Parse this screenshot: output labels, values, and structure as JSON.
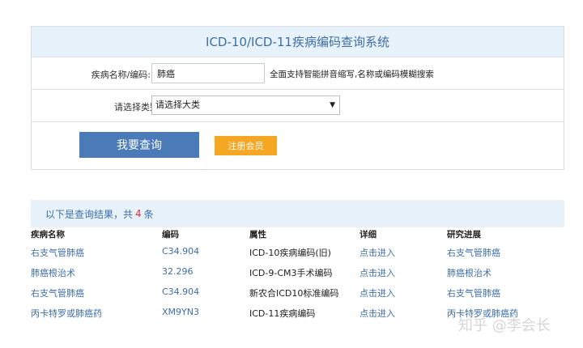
{
  "form": {
    "title": "ICD-10/ICD-11疾病编码查询系统",
    "name_label": "疾病名称/编码:",
    "name_value": "肺癌",
    "name_hint": "全面支持智能拼音缩写,名称或编码模糊搜索",
    "category_label": "请选择类别",
    "category_selected": "请选择大类",
    "search_button": "我要查询",
    "register_button": "注册会员"
  },
  "results": {
    "prefix": "以下是查询结果，共",
    "count": "4",
    "suffix": "条",
    "headers": [
      "疾病名称",
      "编码",
      "属性",
      "详细",
      "研究进展"
    ],
    "rows": [
      [
        "右支气管肺癌",
        "C34.904",
        "ICD-10疾病编码(旧)",
        "点击进入",
        "右支气管肺癌"
      ],
      [
        "肺癌根治术",
        "32.296",
        "ICD-9-CM3手术编码",
        "点击进入",
        "肺癌根治术"
      ],
      [
        "右支气管肺癌",
        "C34.904",
        "新农合ICD10标准编码",
        "点击进入",
        "右支气管肺癌"
      ],
      [
        "丙卡特罗或肺癌药",
        "XM9YN3",
        "ICD-11疾病编码",
        "点击进入",
        "丙卡特罗或肺癌药"
      ]
    ]
  },
  "watermark": "知乎 @李会长",
  "colors": {
    "accent_blue": "#4a7ab8",
    "link_blue": "#3d6ea8",
    "orange": "#f5a623",
    "header_bg": "#e8f2fb",
    "count_red": "#d33333"
  }
}
